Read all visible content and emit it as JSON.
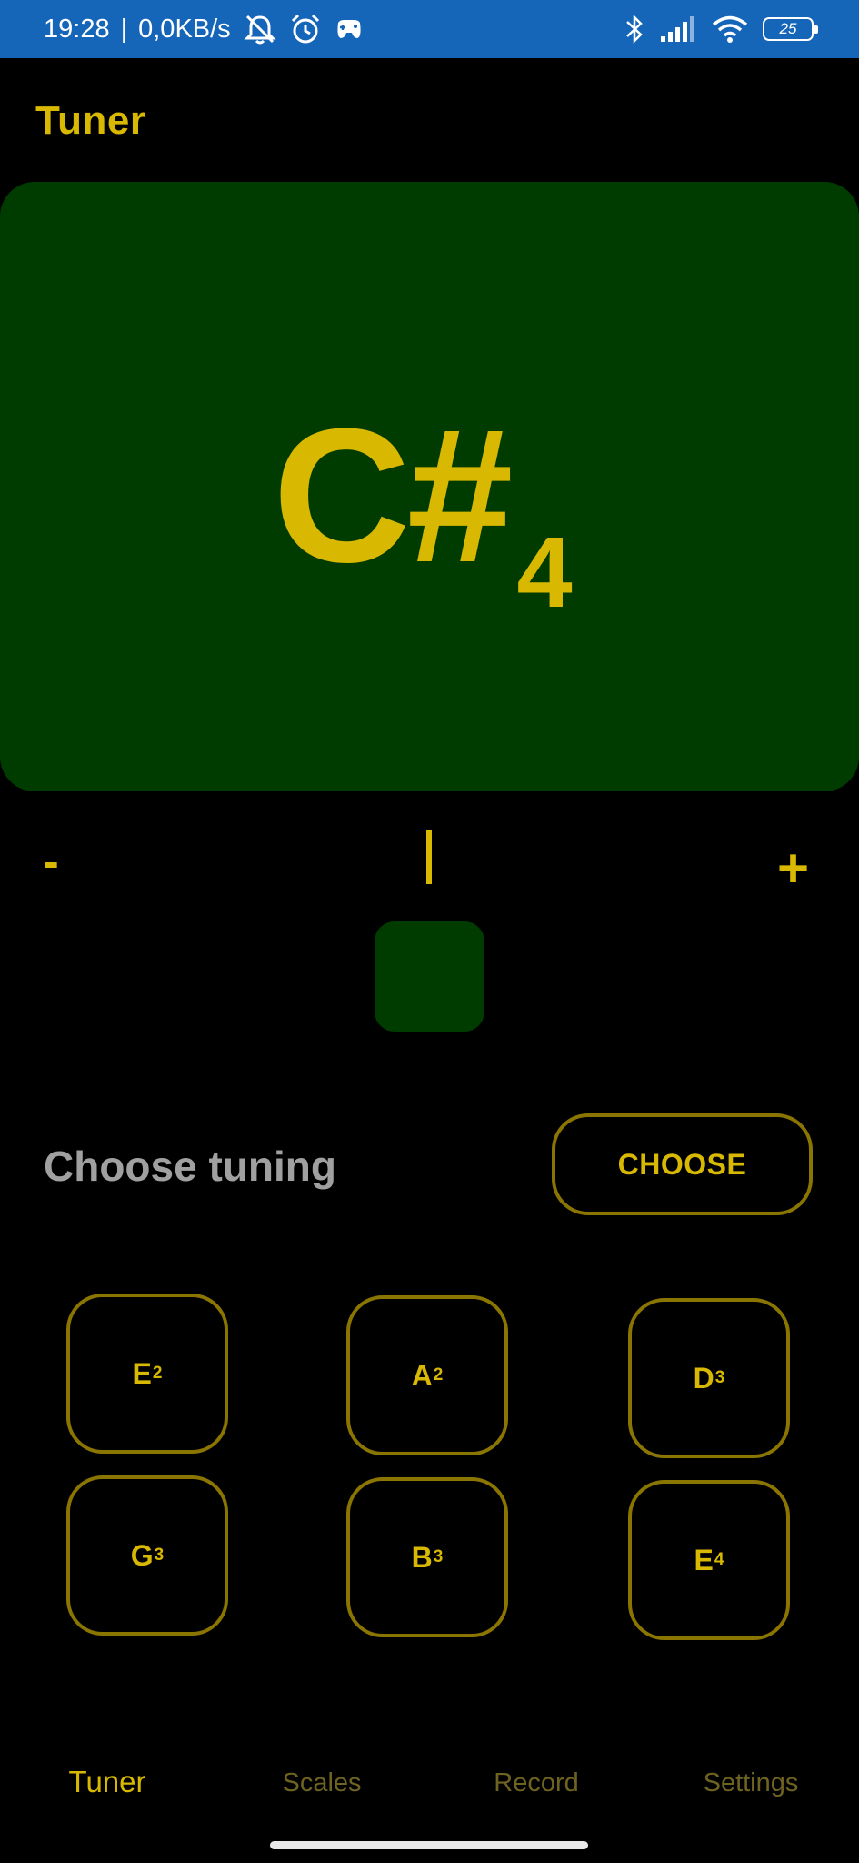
{
  "status_bar": {
    "time": "19:28",
    "separator": "|",
    "speed": "0,0KB/s",
    "battery": "25",
    "icons": [
      "mute-notifications-icon",
      "alarm-icon",
      "game-controller-icon",
      "bluetooth-icon",
      "signal-icon",
      "wifi-icon",
      "battery-icon"
    ]
  },
  "app": {
    "title": "Tuner"
  },
  "tuner": {
    "note": "C#",
    "octave": "4",
    "minus_label": "-",
    "plus_label": "+",
    "colors": {
      "accent": "#d8b800",
      "card": "#003b00",
      "border": "#8a7500",
      "statusbar": "#1565b8"
    }
  },
  "tuning": {
    "label": "Choose tuning",
    "button_label": "CHOOSE"
  },
  "strings": [
    {
      "note": "E",
      "octave": "2"
    },
    {
      "note": "A",
      "octave": "2"
    },
    {
      "note": "D",
      "octave": "3"
    },
    {
      "note": "G",
      "octave": "3"
    },
    {
      "note": "B",
      "octave": "3"
    },
    {
      "note": "E",
      "octave": "4"
    }
  ],
  "nav": {
    "items": [
      {
        "label": "Tuner",
        "active": true
      },
      {
        "label": "Scales",
        "active": false
      },
      {
        "label": "Record",
        "active": false
      },
      {
        "label": "Settings",
        "active": false
      }
    ]
  }
}
